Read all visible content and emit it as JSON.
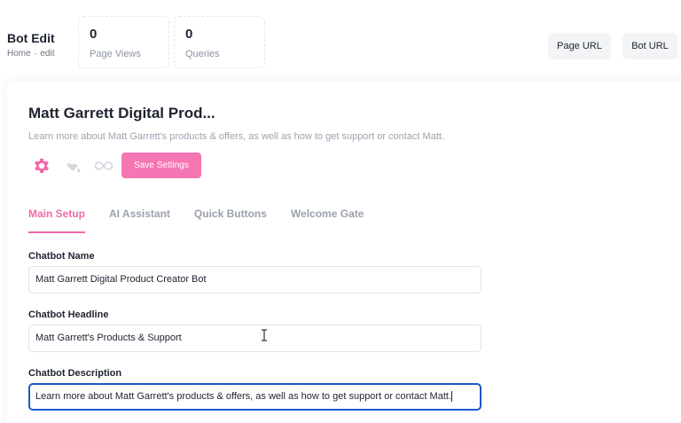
{
  "header": {
    "title": "Bot Edit",
    "breadcrumb": {
      "home": "Home",
      "separator": "-",
      "current": "edit"
    },
    "stats": [
      {
        "value": "0",
        "label": "Page Views"
      },
      {
        "value": "0",
        "label": "Queries"
      }
    ],
    "buttons": {
      "page_url": "Page URL",
      "bot_url": "Bot URL"
    }
  },
  "bot": {
    "name": "Matt Garrett Digital Prod...",
    "description": "Learn more about Matt Garrett's products & offers, as well as how to get support or contact Matt.",
    "icons": [
      "gear-icon",
      "paint-bucket-icon",
      "infinity-icon"
    ],
    "save_label": "Save Settings"
  },
  "tabs": [
    "Main Setup",
    "AI Assistant",
    "Quick Buttons",
    "Welcome Gate"
  ],
  "active_tab": "Main Setup",
  "form": {
    "name_label": "Chatbot Name",
    "name_value": "Matt Garrett Digital Product Creator Bot",
    "headline_label": "Chatbot Headline",
    "headline_value": "Matt Garrett's Products & Support",
    "description_label": "Chatbot Description",
    "description_value": "Learn more about Matt Garrett's products & offers, as well as how to get support or contact Matt."
  },
  "colors": {
    "accent": "#f06aa9",
    "save_button": "#f675b3",
    "focus_border": "#1e56c8",
    "muted_text": "#9aa1ae"
  }
}
